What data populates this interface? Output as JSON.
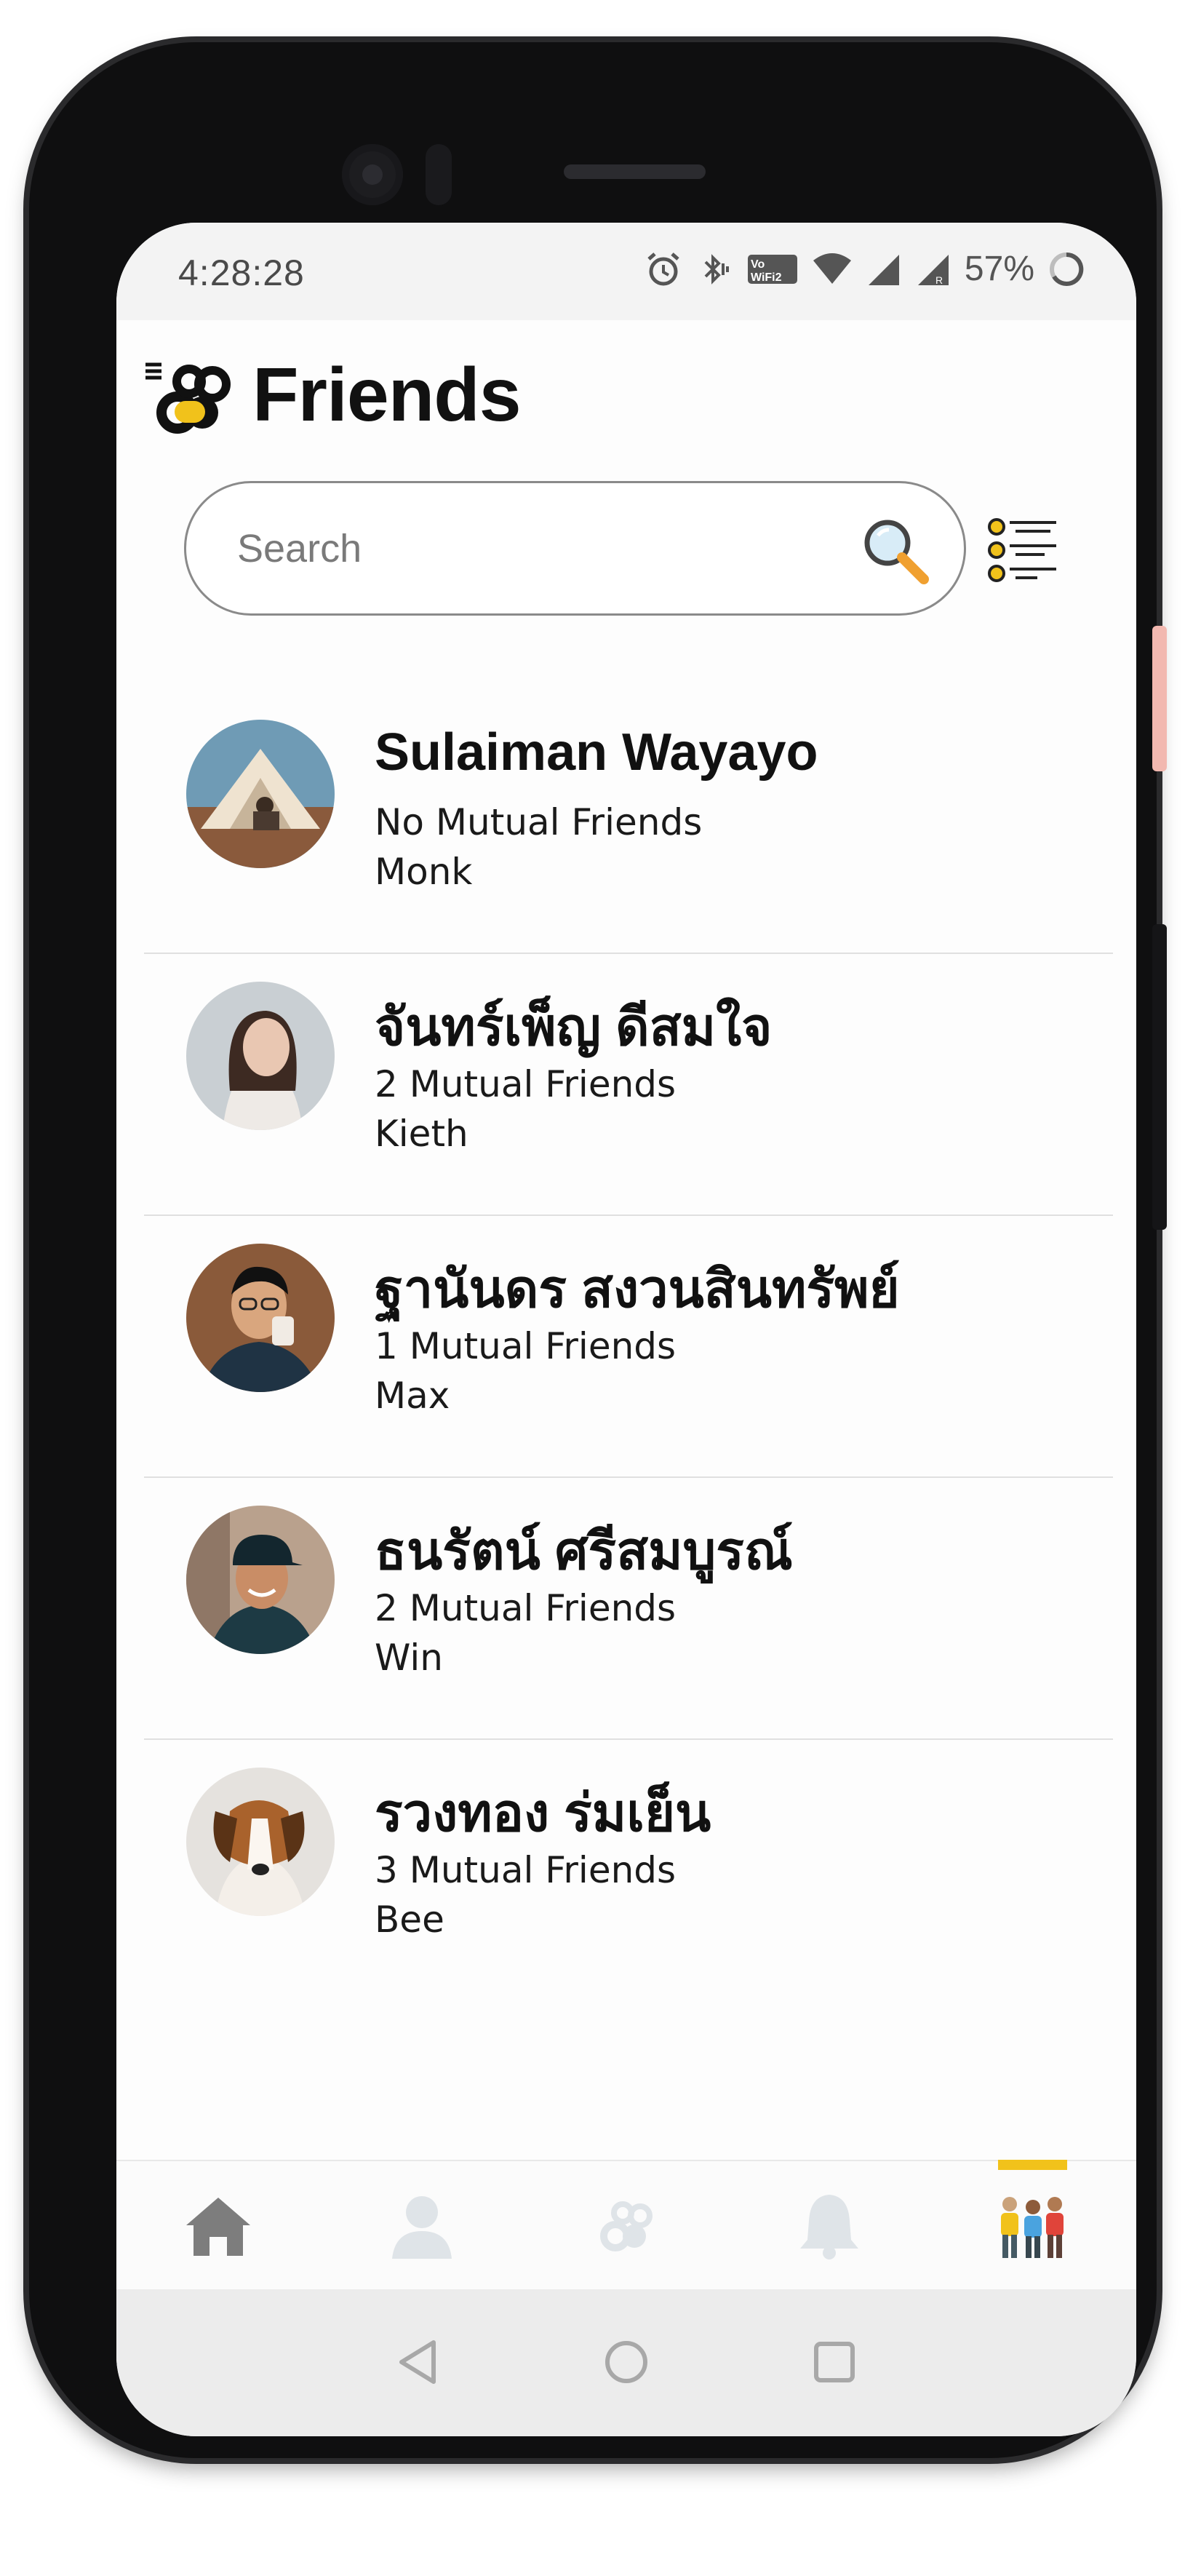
{
  "status_bar": {
    "time": "4:28:28",
    "battery_percent": "57%",
    "wifi_call_label": "VoWiFi2"
  },
  "header": {
    "title": "Friends"
  },
  "search": {
    "placeholder": "Search",
    "value": ""
  },
  "friends": [
    {
      "name": "Sulaiman Wayayo",
      "mutual": "No Mutual Friends",
      "nickname": "Monk"
    },
    {
      "name": "จันทร์เพ็ญ ดีสมใจ",
      "mutual": "2 Mutual Friends",
      "nickname": "Kieth"
    },
    {
      "name": "ฐานันดร สงวนสินทรัพย์",
      "mutual": "1 Mutual Friends",
      "nickname": "Max"
    },
    {
      "name": "ธนรัตน์ ศรีสมบูรณ์",
      "mutual": "2 Mutual Friends",
      "nickname": "Win"
    },
    {
      "name": "รวงทอง ร่มเย็น",
      "mutual": "3 Mutual Friends",
      "nickname": "Bee"
    }
  ],
  "bottom_nav": {
    "items": [
      "home-icon",
      "profile-icon",
      "app-logo-icon",
      "notifications-icon",
      "friends-icon"
    ],
    "active": "friends-icon"
  },
  "colors": {
    "accent": "#f1c21b",
    "search_icon_handle": "#f0a030",
    "inactive_icon": "#dfe4e8",
    "home_icon": "#7d7d7d"
  }
}
